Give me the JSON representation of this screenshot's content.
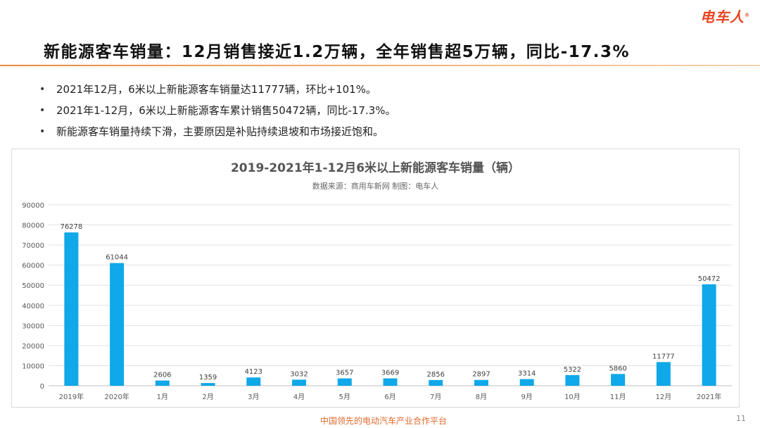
{
  "brand": {
    "logo_text": "电车人",
    "registered_mark": "®"
  },
  "header": {
    "title": "新能源客车销量：12月销售接近1.2万辆，全年销售超5万辆，同比-17.3%"
  },
  "bullets": [
    "2021年12月，6米以上新能源客车销量达11777辆，环比+101%。",
    "2021年1-12月，6米以上新能源客车累计销售50472辆，同比-17.3%。",
    "新能源客车销量持续下滑，主要原因是补贴持续退坡和市场接近饱和。"
  ],
  "bullet_marker": "•",
  "chart_data": {
    "type": "bar",
    "title": "2019-2021年1-12月6米以上新能源客车销量（辆）",
    "subtitle": "数据来源：商用车新网    制图：电车人",
    "categories": [
      "2019年",
      "2020年",
      "1月",
      "2月",
      "3月",
      "4月",
      "5月",
      "6月",
      "7月",
      "8月",
      "9月",
      "10月",
      "11月",
      "12月",
      "2021年"
    ],
    "values": [
      76278,
      61044,
      2606,
      1359,
      4123,
      3032,
      3657,
      3669,
      2856,
      2897,
      3314,
      5322,
      5860,
      11777,
      50472
    ],
    "ylim": [
      0,
      90000
    ],
    "yticks": [
      0,
      10000,
      20000,
      30000,
      40000,
      50000,
      60000,
      70000,
      80000,
      90000
    ],
    "data_labels": true,
    "grid": true,
    "legend": "none",
    "bar_color": "#0fa8e8",
    "xlabel": "",
    "ylabel": ""
  },
  "footer": {
    "text": "中国领先的电动汽车产业合作平台",
    "page_number": "11"
  },
  "colors": {
    "accent": "#e8441f",
    "footer": "#e06a2c",
    "rule": "#e6883c"
  }
}
